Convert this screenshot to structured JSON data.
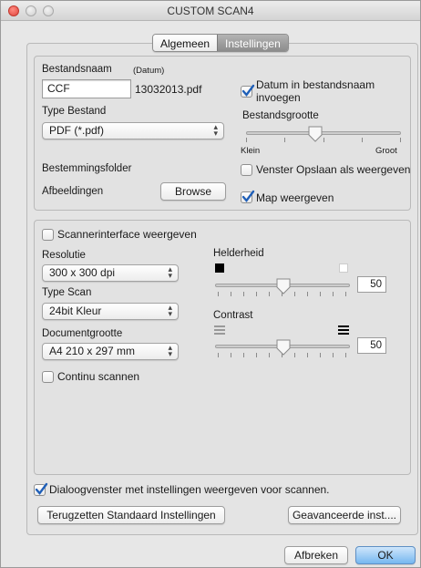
{
  "window": {
    "title": "CUSTOM SCAN4"
  },
  "tabs": [
    {
      "label": "Algemeen"
    },
    {
      "label": "Instellingen"
    }
  ],
  "file": {
    "name_label": "Bestandsnaam",
    "datum_hint": "(Datum)",
    "name_value": "CCF",
    "name_suffix": "13032013.pdf",
    "date_checkbox_label_line1": "Datum in bestandsnaam",
    "date_checkbox_label_line2": "invoegen",
    "date_checked": true,
    "type_label": "Type Bestand",
    "type_value": "PDF (*.pdf)",
    "size_label": "Bestandsgrootte",
    "size_min_label": "Klein",
    "size_max_label": "Groot",
    "size_level": 0.5,
    "folder_label": "Bestemmingsfolder",
    "folder_value": "Afbeeldingen",
    "browse_label": "Browse",
    "save_as_label": "Venster Opslaan als weergeven",
    "save_as_checked": false,
    "show_folder_label": "Map weergeven",
    "show_folder_checked": true
  },
  "scan": {
    "scanner_interface_label": "Scannerinterface weergeven",
    "scanner_interface_checked": false,
    "resolution_label": "Resolutie",
    "resolution_value": "300 x 300 dpi",
    "scan_type_label": "Type Scan",
    "scan_type_value": "24bit Kleur",
    "doc_size_label": "Documentgrootte",
    "doc_size_value": "A4 210 x 297 mm",
    "continuous_label": "Continu scannen",
    "continuous_checked": false,
    "brightness_label": "Helderheid",
    "brightness_value": "50",
    "contrast_label": "Contrast",
    "contrast_value": "50"
  },
  "bottom": {
    "dialog_label": "Dialoogvenster met instellingen weergeven voor scannen.",
    "dialog_checked": true,
    "reset_label": "Terugzetten Standaard Instellingen",
    "advanced_label": "Geavanceerde inst...."
  },
  "footer": {
    "cancel_label": "Afbreken",
    "ok_label": "OK"
  },
  "colors": {
    "checkmark": "#1f5fb8",
    "default_button": "#76b7f0"
  }
}
